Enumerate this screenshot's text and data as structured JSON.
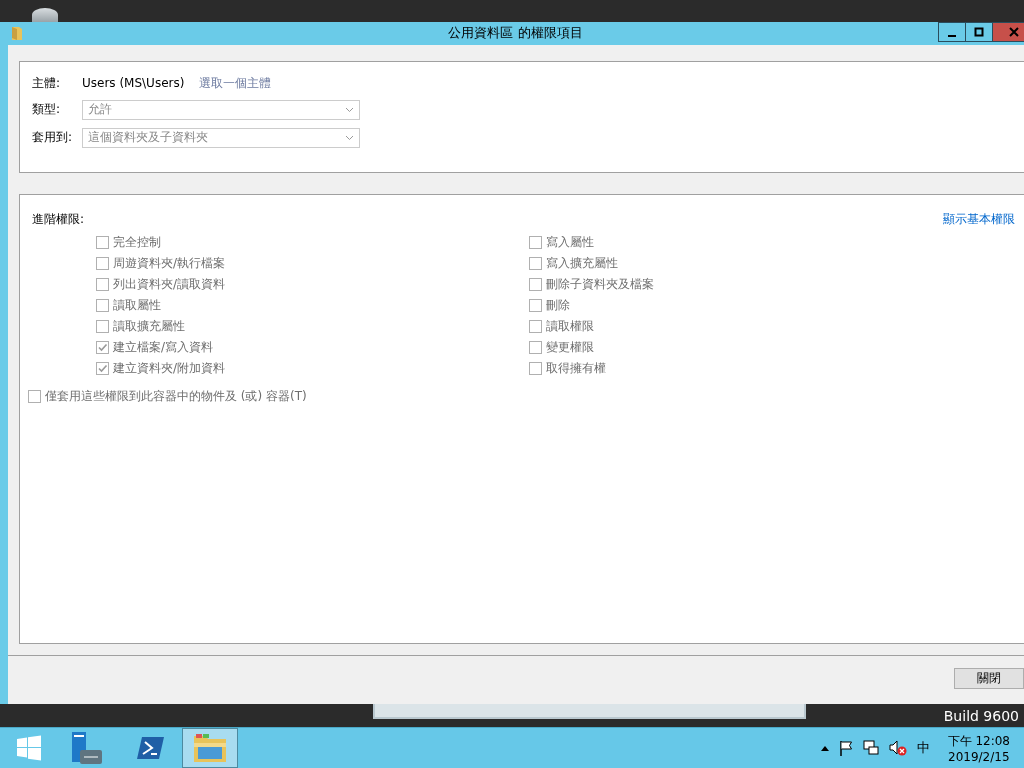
{
  "window": {
    "title": "公用資料區 的權限項目"
  },
  "principal": {
    "label": "主體:",
    "value": "Users (MS\\Users)",
    "link": "選取一個主體"
  },
  "fields": [
    {
      "label": "類型:",
      "value": "允許",
      "disabled": true
    },
    {
      "label": "套用到:",
      "value": "這個資料夾及子資料夾",
      "disabled": true
    }
  ],
  "permissions": {
    "title": "進階權限:",
    "link": "顯示基本權限",
    "left": [
      {
        "label": "完全控制",
        "checked": false,
        "disabled": true
      },
      {
        "label": "周遊資料夾/執行檔案",
        "checked": false,
        "disabled": true
      },
      {
        "label": "列出資料夾/讀取資料",
        "checked": false,
        "disabled": true
      },
      {
        "label": "讀取屬性",
        "checked": false,
        "disabled": true
      },
      {
        "label": "讀取擴充屬性",
        "checked": false,
        "disabled": true
      },
      {
        "label": "建立檔案/寫入資料",
        "checked": true,
        "disabled": true
      },
      {
        "label": "建立資料夾/附加資料",
        "checked": true,
        "disabled": true
      }
    ],
    "right": [
      {
        "label": "寫入屬性",
        "checked": false,
        "disabled": true
      },
      {
        "label": "寫入擴充屬性",
        "checked": false,
        "disabled": true
      },
      {
        "label": "刪除子資料夾及檔案",
        "checked": false,
        "disabled": true
      },
      {
        "label": "刪除",
        "checked": false,
        "disabled": true
      },
      {
        "label": "讀取權限",
        "checked": false,
        "disabled": true
      },
      {
        "label": "變更權限",
        "checked": false,
        "disabled": true
      },
      {
        "label": "取得擁有權",
        "checked": false,
        "disabled": true
      }
    ],
    "apply_only": {
      "label": "僅套用這些權限到此容器中的物件及 (或) 容器(T)",
      "checked": false,
      "disabled": true
    }
  },
  "buttons": [
    "關閉"
  ],
  "desktop": {
    "build": "Build 9600"
  },
  "taskbar": {
    "apps": [
      {
        "kind": "start",
        "selected": false
      },
      {
        "kind": "server",
        "selected": false
      },
      {
        "kind": "shell",
        "selected": false
      },
      {
        "kind": "explorer",
        "selected": true
      }
    ],
    "ime": "中",
    "time": "下午 12:08",
    "date": "2019/2/15"
  }
}
